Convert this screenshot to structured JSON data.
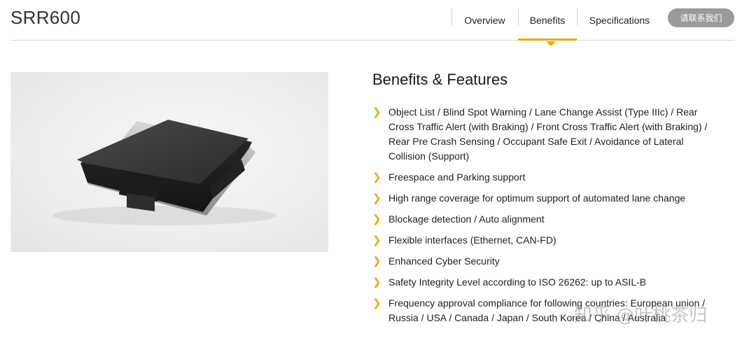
{
  "header": {
    "title": "SRR600",
    "nav": [
      {
        "label": "Overview",
        "active": false
      },
      {
        "label": "Benefits",
        "active": true
      },
      {
        "label": "Specifications",
        "active": false
      }
    ],
    "contact_button": "请联系我们",
    "accent_color": "#f5a800"
  },
  "main": {
    "heading": "Benefits & Features",
    "bullet_icon": "chevron-right-icon",
    "features": [
      "Object List / Blind Spot Warning / Lane Change Assist (Type IIIc) / Rear Cross Traffic Alert (with Braking) / Front Cross Traffic Alert (with Braking) / Rear Pre Crash Sensing / Occupant Safe Exit / Avoidance of Lateral Collision (Support)",
      "Freespace and Parking support",
      "High range coverage for optimum support of automated lane change",
      "Blockage detection / Auto alignment",
      "Flexible interfaces (Ethernet, CAN-FD)",
      "Enhanced Cyber Security",
      "Safety Integrity Level according to ISO 26262: up to ASIL-B",
      "Frequency approval compliance for following countries: European union / Russia / USA / Canada / Japan / South Korea / China / Australia"
    ]
  },
  "watermark": "知乎 @叶桃茶归"
}
